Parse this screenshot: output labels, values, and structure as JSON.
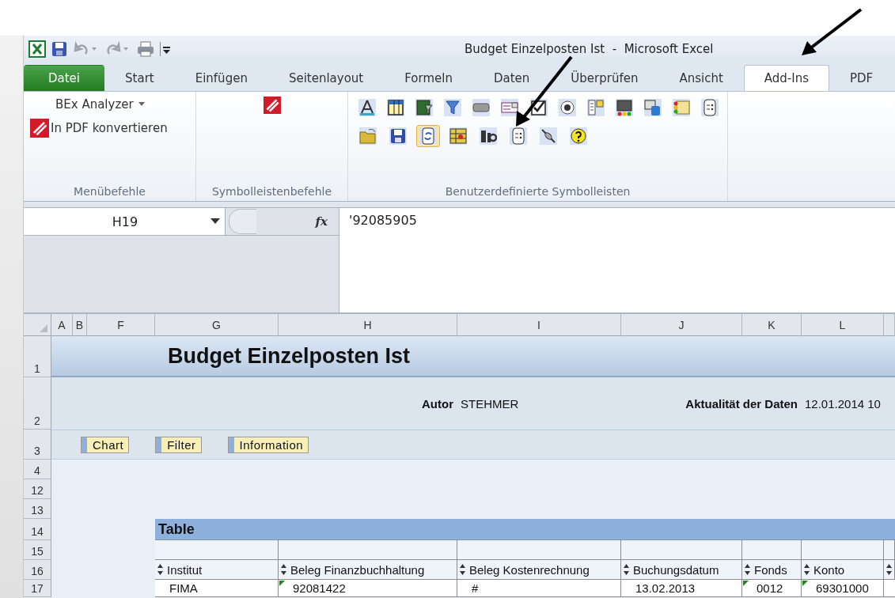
{
  "window": {
    "title": "Budget Einzelposten Ist  -  Microsoft Excel"
  },
  "tabs": [
    {
      "label": "Datei",
      "kind": "file",
      "selected": false
    },
    {
      "label": "Start",
      "kind": "tab",
      "selected": false
    },
    {
      "label": "Einfügen",
      "kind": "tab",
      "selected": false
    },
    {
      "label": "Seitenlayout",
      "kind": "tab",
      "selected": false
    },
    {
      "label": "Formeln",
      "kind": "tab",
      "selected": false
    },
    {
      "label": "Daten",
      "kind": "tab",
      "selected": false
    },
    {
      "label": "Überprüfen",
      "kind": "tab",
      "selected": false
    },
    {
      "label": "Ansicht",
      "kind": "tab",
      "selected": false
    },
    {
      "label": "Add-Ins",
      "kind": "tab",
      "selected": true
    },
    {
      "label": "PDF",
      "kind": "tab",
      "selected": false
    }
  ],
  "ribbon": {
    "groups": [
      {
        "label": "Menübefehle",
        "menu": "BEx Analyzer",
        "command": "In PDF konvertieren"
      },
      {
        "label": "Symbolleistenbefehle"
      },
      {
        "label": "Benutzerdefinierte Symbolleisten",
        "tools": [
          [
            {
              "selected": false
            },
            {
              "selected": false
            },
            {
              "selected": false
            },
            {
              "selected": false
            },
            {
              "selected": false
            },
            {
              "selected": false
            },
            {
              "selected": false
            },
            {
              "selected": false
            },
            {
              "selected": false
            },
            {
              "selected": false
            },
            {
              "selected": false
            },
            {
              "selected": false
            },
            {
              "selected": false
            }
          ],
          [
            {
              "selected": false
            },
            {
              "selected": false
            },
            {
              "selected": true
            },
            {
              "selected": false
            },
            {
              "selected": false
            },
            {
              "selected": false
            },
            {
              "selected": false
            },
            {
              "selected": false
            }
          ]
        ]
      }
    ]
  },
  "formula_bar": {
    "name_box": "H19",
    "function_label": "fx",
    "value": "'92085905"
  },
  "sheet": {
    "columns": [
      "A",
      "B",
      "F",
      "G",
      "H",
      "I",
      "J",
      "K",
      "L"
    ],
    "rows": [
      "1",
      "2",
      "3",
      "4",
      "12",
      "13",
      "14",
      "15",
      "16",
      "17"
    ],
    "report_title": "Budget Einzelposten Ist",
    "author_label": "Autor",
    "author": "STEHMER",
    "freshness_label": "Aktualität der Daten",
    "freshness": "12.01.2014 10",
    "buttons": [
      "Chart",
      "Filter",
      "Information"
    ],
    "table": {
      "title": "Table",
      "headers": [
        "Institut",
        "Beleg Finanzbuchhaltung",
        "Beleg Kostenrechnung",
        "Buchungsdatum",
        "Fonds",
        "Konto"
      ],
      "rows": [
        [
          {
            "text": "FIMA",
            "flagged": false
          },
          {
            "text": "92081422",
            "flagged": true
          },
          {
            "text": "#",
            "flagged": false
          },
          {
            "text": "13.02.2013",
            "flagged": false
          },
          {
            "text": "0012",
            "flagged": true
          },
          {
            "text": "69301000",
            "flagged": true
          }
        ]
      ]
    }
  }
}
